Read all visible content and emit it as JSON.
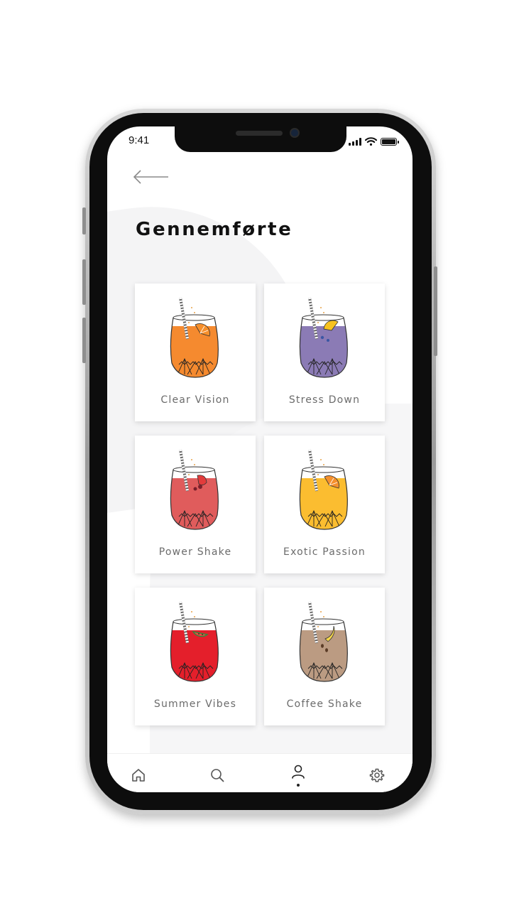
{
  "status_bar": {
    "time": "9:41"
  },
  "header": {
    "title": "Gennemførte"
  },
  "cards": [
    {
      "label": "Clear Vision",
      "liquid_color": "#f58a2f",
      "fruit_color": "#f7902c",
      "fruit": "orange"
    },
    {
      "label": "Stress Down",
      "liquid_color": "#8b7bb5",
      "fruit_color": "#f7c21f",
      "fruit": "lemon"
    },
    {
      "label": "Power Shake",
      "liquid_color": "#e05c5c",
      "fruit_color": "#e23b3b",
      "fruit": "strawberry"
    },
    {
      "label": "Exotic Passion",
      "liquid_color": "#fbbd30",
      "fruit_color": "#f5902d",
      "fruit": "grapefruit"
    },
    {
      "label": "Summer Vibes",
      "liquid_color": "#e41f2b",
      "fruit_color": "#ef4b3e",
      "fruit": "watermelon"
    },
    {
      "label": "Coffee Shake",
      "liquid_color": "#bb9b82",
      "fruit_color": "#f6d64a",
      "fruit": "banana"
    }
  ],
  "tab_bar": {
    "tabs": [
      {
        "icon": "home-icon"
      },
      {
        "icon": "search-icon"
      },
      {
        "icon": "profile-icon",
        "active": true
      },
      {
        "icon": "settings-icon"
      }
    ]
  },
  "colors": {
    "text": "#111111",
    "label": "#6b6b6b",
    "background": "#ffffff"
  }
}
